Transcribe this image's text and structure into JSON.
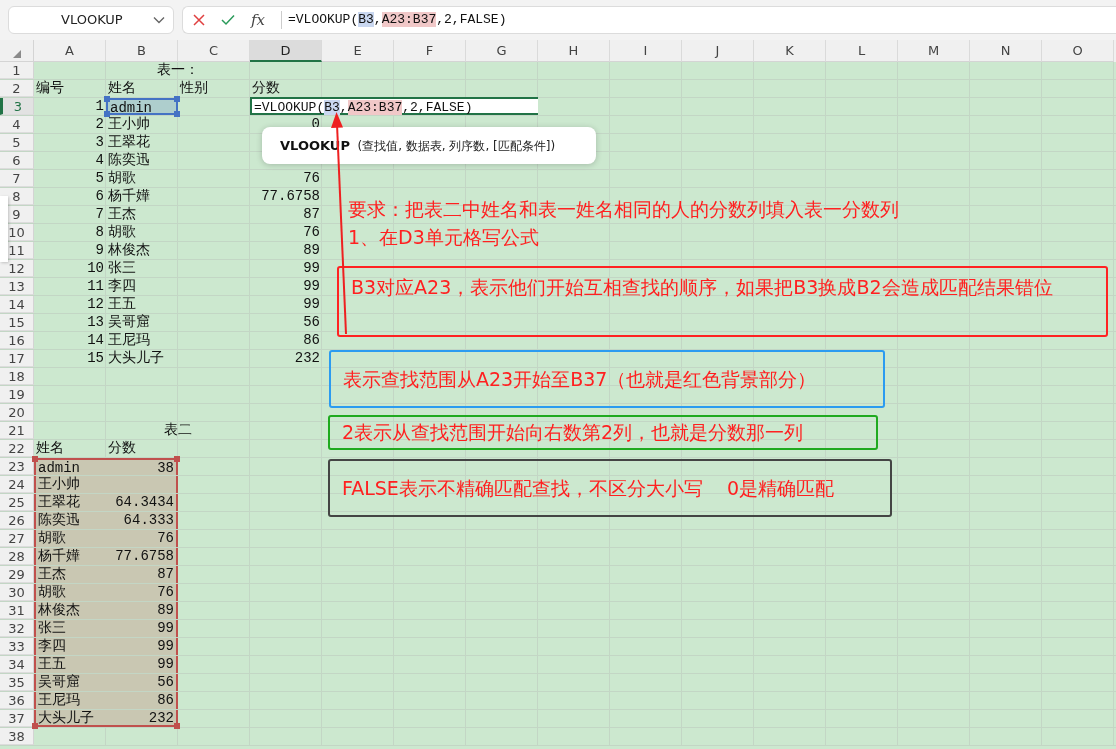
{
  "name_box": "VLOOKUP",
  "formula_bar": {
    "function_label": "fx",
    "parts": [
      {
        "text": "=VLOOKUP("
      },
      {
        "text": "B3",
        "color": "#c9d7f0"
      },
      {
        "text": ","
      },
      {
        "text": "A23:B37",
        "color": "#f1c8c8"
      },
      {
        "text": ",2,FALSE)"
      }
    ]
  },
  "columns": [
    {
      "label": "A",
      "selected": false
    },
    {
      "label": "B",
      "selected": false
    },
    {
      "label": "C",
      "selected": false
    },
    {
      "label": "D",
      "selected": true
    },
    {
      "label": "E",
      "selected": false
    },
    {
      "label": "F",
      "selected": false
    },
    {
      "label": "G",
      "selected": false
    },
    {
      "label": "H",
      "selected": false
    },
    {
      "label": "I",
      "selected": false
    },
    {
      "label": "J",
      "selected": false
    },
    {
      "label": "K",
      "selected": false
    },
    {
      "label": "L",
      "selected": false
    },
    {
      "label": "M",
      "selected": false
    },
    {
      "label": "N",
      "selected": false
    },
    {
      "label": "O",
      "selected": false
    }
  ],
  "rows": [
    {
      "label": "1",
      "selected": false,
      "cells": [
        {
          "kind": "title",
          "text": "表一："
        }
      ]
    },
    {
      "label": "2",
      "selected": false,
      "cells": [
        {
          "kind": "text",
          "text": "编号"
        },
        {
          "kind": "text",
          "text": "姓名"
        },
        {
          "kind": "text",
          "text": "性别"
        },
        {
          "kind": "text",
          "text": "分数"
        }
      ]
    },
    {
      "label": "3",
      "selected": true,
      "cells": [
        {
          "kind": "number",
          "text": "1"
        },
        {
          "kind": "text",
          "text": "admin",
          "color": "#4472c4"
        },
        null,
        {
          "kind": "formula",
          "parts": [
            {
              "text": "=VLOOKUP("
            },
            {
              "text": "B3",
              "color": "#c9d7f0"
            },
            {
              "text": ","
            },
            {
              "text": "A23:B37",
              "color": "#f1c8c8"
            },
            {
              "text": ",2,FALSE)"
            }
          ]
        }
      ]
    },
    {
      "label": "4",
      "selected": false,
      "cells": [
        {
          "kind": "number",
          "text": "2"
        },
        {
          "kind": "text",
          "text": "王小帅"
        },
        null,
        {
          "kind": "number",
          "text": "0"
        }
      ]
    },
    {
      "label": "5",
      "selected": false,
      "cells": [
        {
          "kind": "number",
          "text": "3"
        },
        {
          "kind": "text",
          "text": "王翠花"
        }
      ]
    },
    {
      "label": "6",
      "selected": false,
      "cells": [
        {
          "kind": "number",
          "text": "4"
        },
        {
          "kind": "text",
          "text": "陈奕迅"
        }
      ]
    },
    {
      "label": "7",
      "selected": false,
      "cells": [
        {
          "kind": "number",
          "text": "5"
        },
        {
          "kind": "text",
          "text": "胡歌"
        },
        null,
        {
          "kind": "number",
          "text": "76"
        }
      ]
    },
    {
      "label": "8",
      "selected": false,
      "cells": [
        {
          "kind": "number",
          "text": "6"
        },
        {
          "kind": "text",
          "text": "杨千嬅"
        },
        null,
        {
          "kind": "number",
          "text": "77.6758"
        }
      ]
    },
    {
      "label": "9",
      "selected": false,
      "cells": [
        {
          "kind": "number",
          "text": "7"
        },
        {
          "kind": "text",
          "text": "王杰"
        },
        null,
        {
          "kind": "number",
          "text": "87"
        }
      ]
    },
    {
      "label": "10",
      "selected": false,
      "cells": [
        {
          "kind": "number",
          "text": "8"
        },
        {
          "kind": "text",
          "text": "胡歌"
        },
        null,
        {
          "kind": "number",
          "text": "76"
        }
      ]
    },
    {
      "label": "11",
      "selected": false,
      "cells": [
        {
          "kind": "number",
          "text": "9"
        },
        {
          "kind": "text",
          "text": "林俊杰"
        },
        null,
        {
          "kind": "number",
          "text": "89"
        }
      ]
    },
    {
      "label": "12",
      "selected": false,
      "cells": [
        {
          "kind": "number",
          "text": "10"
        },
        {
          "kind": "text",
          "text": "张三"
        },
        null,
        {
          "kind": "number",
          "text": "99"
        }
      ]
    },
    {
      "label": "13",
      "selected": false,
      "cells": [
        {
          "kind": "number",
          "text": "11"
        },
        {
          "kind": "text",
          "text": "李四"
        },
        null,
        {
          "kind": "number",
          "text": "99"
        }
      ]
    },
    {
      "label": "14",
      "selected": false,
      "cells": [
        {
          "kind": "number",
          "text": "12"
        },
        {
          "kind": "text",
          "text": "王五"
        },
        null,
        {
          "kind": "number",
          "text": "99"
        }
      ]
    },
    {
      "label": "15",
      "selected": false,
      "cells": [
        {
          "kind": "number",
          "text": "13"
        },
        {
          "kind": "text",
          "text": "吴哥窟"
        },
        null,
        {
          "kind": "number",
          "text": "56"
        }
      ]
    },
    {
      "label": "16",
      "selected": false,
      "cells": [
        {
          "kind": "number",
          "text": "14"
        },
        {
          "kind": "text",
          "text": "王尼玛"
        },
        null,
        {
          "kind": "number",
          "text": "86"
        }
      ]
    },
    {
      "label": "17",
      "selected": false,
      "cells": [
        {
          "kind": "number",
          "text": "15"
        },
        {
          "kind": "text",
          "text": "大头儿子"
        },
        null,
        {
          "kind": "number",
          "text": "232"
        }
      ]
    },
    {
      "label": "18",
      "selected": false
    },
    {
      "label": "19",
      "selected": false
    },
    {
      "label": "20",
      "selected": false
    },
    {
      "label": "21",
      "selected": false,
      "cells": [
        {
          "kind": "title",
          "text": "表二"
        }
      ]
    },
    {
      "label": "22",
      "selected": false,
      "cells": [
        {
          "kind": "text",
          "text": "姓名"
        },
        {
          "kind": "text",
          "text": "分数"
        }
      ]
    },
    {
      "label": "23",
      "selected": false,
      "cells": [
        {
          "kind": "text",
          "text": "admin",
          "color": "#c0504d"
        },
        {
          "kind": "number",
          "text": "38",
          "color": "#c0504d"
        }
      ]
    },
    {
      "label": "24",
      "selected": false,
      "cells": [
        {
          "kind": "text",
          "text": "王小帅",
          "color": "#c0504d"
        },
        {
          "kind": "number",
          "color": "#c0504d"
        }
      ]
    },
    {
      "label": "25",
      "selected": false,
      "cells": [
        {
          "kind": "text",
          "text": "王翠花",
          "color": "#c0504d"
        },
        {
          "kind": "number",
          "text": "64.3434",
          "color": "#c0504d"
        }
      ]
    },
    {
      "label": "26",
      "selected": false,
      "cells": [
        {
          "kind": "text",
          "text": "陈奕迅",
          "color": "#c0504d"
        },
        {
          "kind": "number",
          "text": "64.333",
          "color": "#c0504d"
        }
      ]
    },
    {
      "label": "27",
      "selected": false,
      "cells": [
        {
          "kind": "text",
          "text": "胡歌",
          "color": "#c0504d"
        },
        {
          "kind": "number",
          "text": "76",
          "color": "#c0504d"
        }
      ]
    },
    {
      "label": "28",
      "selected": false,
      "cells": [
        {
          "kind": "text",
          "text": "杨千嬅",
          "color": "#c0504d"
        },
        {
          "kind": "number",
          "text": "77.6758",
          "color": "#c0504d"
        }
      ]
    },
    {
      "label": "29",
      "selected": false,
      "cells": [
        {
          "kind": "text",
          "text": "王杰",
          "color": "#c0504d"
        },
        {
          "kind": "number",
          "text": "87",
          "color": "#c0504d"
        }
      ]
    },
    {
      "label": "30",
      "selected": false,
      "cells": [
        {
          "kind": "text",
          "text": "胡歌",
          "color": "#c0504d"
        },
        {
          "kind": "number",
          "text": "76",
          "color": "#c0504d"
        }
      ]
    },
    {
      "label": "31",
      "selected": false,
      "cells": [
        {
          "kind": "text",
          "text": "林俊杰",
          "color": "#c0504d"
        },
        {
          "kind": "number",
          "text": "89",
          "color": "#c0504d"
        }
      ]
    },
    {
      "label": "32",
      "selected": false,
      "cells": [
        {
          "kind": "text",
          "text": "张三",
          "color": "#c0504d"
        },
        {
          "kind": "number",
          "text": "99",
          "color": "#c0504d"
        }
      ]
    },
    {
      "label": "33",
      "selected": false,
      "cells": [
        {
          "kind": "text",
          "text": "李四",
          "color": "#c0504d"
        },
        {
          "kind": "number",
          "text": "99",
          "color": "#c0504d"
        }
      ]
    },
    {
      "label": "34",
      "selected": false,
      "cells": [
        {
          "kind": "text",
          "text": "王五",
          "color": "#c0504d"
        },
        {
          "kind": "number",
          "text": "99",
          "color": "#c0504d"
        }
      ]
    },
    {
      "label": "35",
      "selected": false,
      "cells": [
        {
          "kind": "text",
          "text": "吴哥窟",
          "color": "#c0504d"
        },
        {
          "kind": "number",
          "text": "56",
          "color": "#c0504d"
        }
      ]
    },
    {
      "label": "36",
      "selected": false,
      "cells": [
        {
          "kind": "text",
          "text": "王尼玛",
          "color": "#c0504d"
        },
        {
          "kind": "number",
          "text": "86",
          "color": "#c0504d"
        }
      ]
    },
    {
      "label": "37",
      "selected": false,
      "cells": [
        {
          "kind": "text",
          "text": "大头儿子",
          "color": "#c0504d"
        },
        {
          "kind": "number",
          "text": "232",
          "color": "#c0504d"
        }
      ]
    },
    {
      "label": "38",
      "selected": false
    }
  ],
  "tooltip": "**VLOOKUP**  (查找值, 数据表, 列序数, [匹配条件])",
  "annotations": [
    {
      "kind": "text",
      "text": "要求：把表二中姓名和表一姓名相同的人的分数列填入表一分数列"
    },
    {
      "kind": "text",
      "text": "1、在D3单元格写公式"
    },
    {
      "kind": "box",
      "color": "#ff2222",
      "text": "B3对应A23，表示他们开始互相查找的顺序，如果把B3换成B2会造成匹配结果错位"
    },
    {
      "kind": "box",
      "color": "#2b9bf0",
      "text": "表示查找范围从A23开始至B37（也就是红色背景部分）"
    },
    {
      "kind": "box",
      "color": "#1faa1f",
      "text": "2表示从查找范围开始向右数第2列，也就是分数那一列"
    },
    {
      "kind": "box",
      "color": "#444444",
      "text": "FALSE表示不精确匹配查找，不区分大小写    0是精确匹配"
    }
  ]
}
